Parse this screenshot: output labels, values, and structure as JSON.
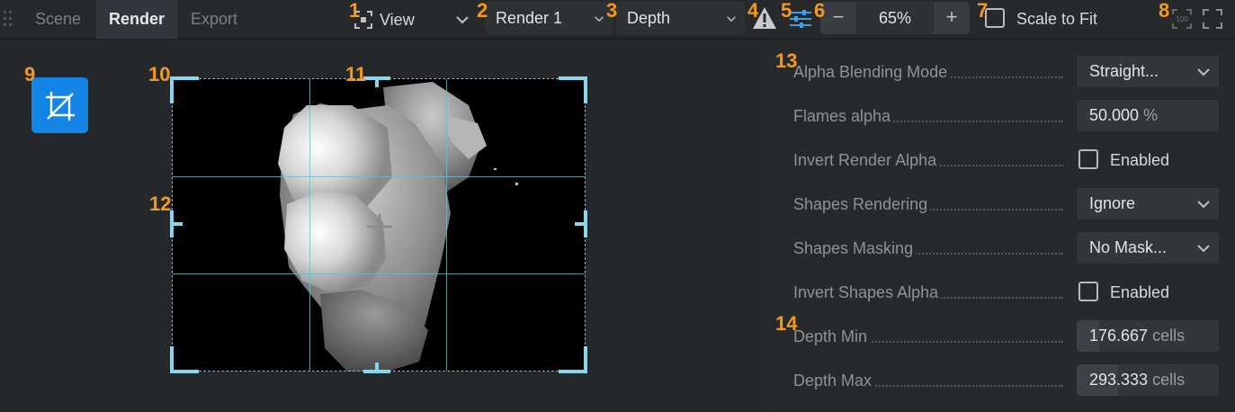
{
  "tabs": [
    {
      "label": "Scene"
    },
    {
      "label": "Render"
    },
    {
      "label": "Export"
    }
  ],
  "toolbar": {
    "view_label": "View",
    "render_select": "Render 1",
    "mode_select": "Depth",
    "zoom_value": "65%",
    "zoom_minus": "−",
    "zoom_plus": "+",
    "scale_to_fit_label": "Scale to Fit",
    "scale_to_fit_checked": false
  },
  "annotations": [
    "1",
    "2",
    "3",
    "4",
    "5",
    "6",
    "7",
    "8",
    "9",
    "10",
    "11",
    "12",
    "13",
    "14"
  ],
  "properties": {
    "alpha_blending_mode": {
      "label": "Alpha Blending Mode",
      "value": "Straight..."
    },
    "flames_alpha": {
      "label": "Flames alpha",
      "value": "50.000",
      "unit": "%",
      "fill": 0
    },
    "invert_render_alpha": {
      "label": "Invert Render Alpha",
      "checkbox_label": "Enabled",
      "checked": false
    },
    "shapes_rendering": {
      "label": "Shapes Rendering",
      "value": "Ignore"
    },
    "shapes_masking": {
      "label": "Shapes Masking",
      "value": "No Mask..."
    },
    "invert_shapes_alpha": {
      "label": "Invert Shapes Alpha",
      "checkbox_label": "Enabled",
      "checked": false
    },
    "depth_min": {
      "label": "Depth Min",
      "value": "176.667",
      "unit": "cells",
      "fill": 0.16
    },
    "depth_max": {
      "label": "Depth Max",
      "value": "293.333",
      "unit": "cells",
      "fill": 0.29
    }
  },
  "colors": {
    "accent": "#1484e6",
    "annotation": "#f39a1e",
    "guide": "#86d6ee"
  }
}
